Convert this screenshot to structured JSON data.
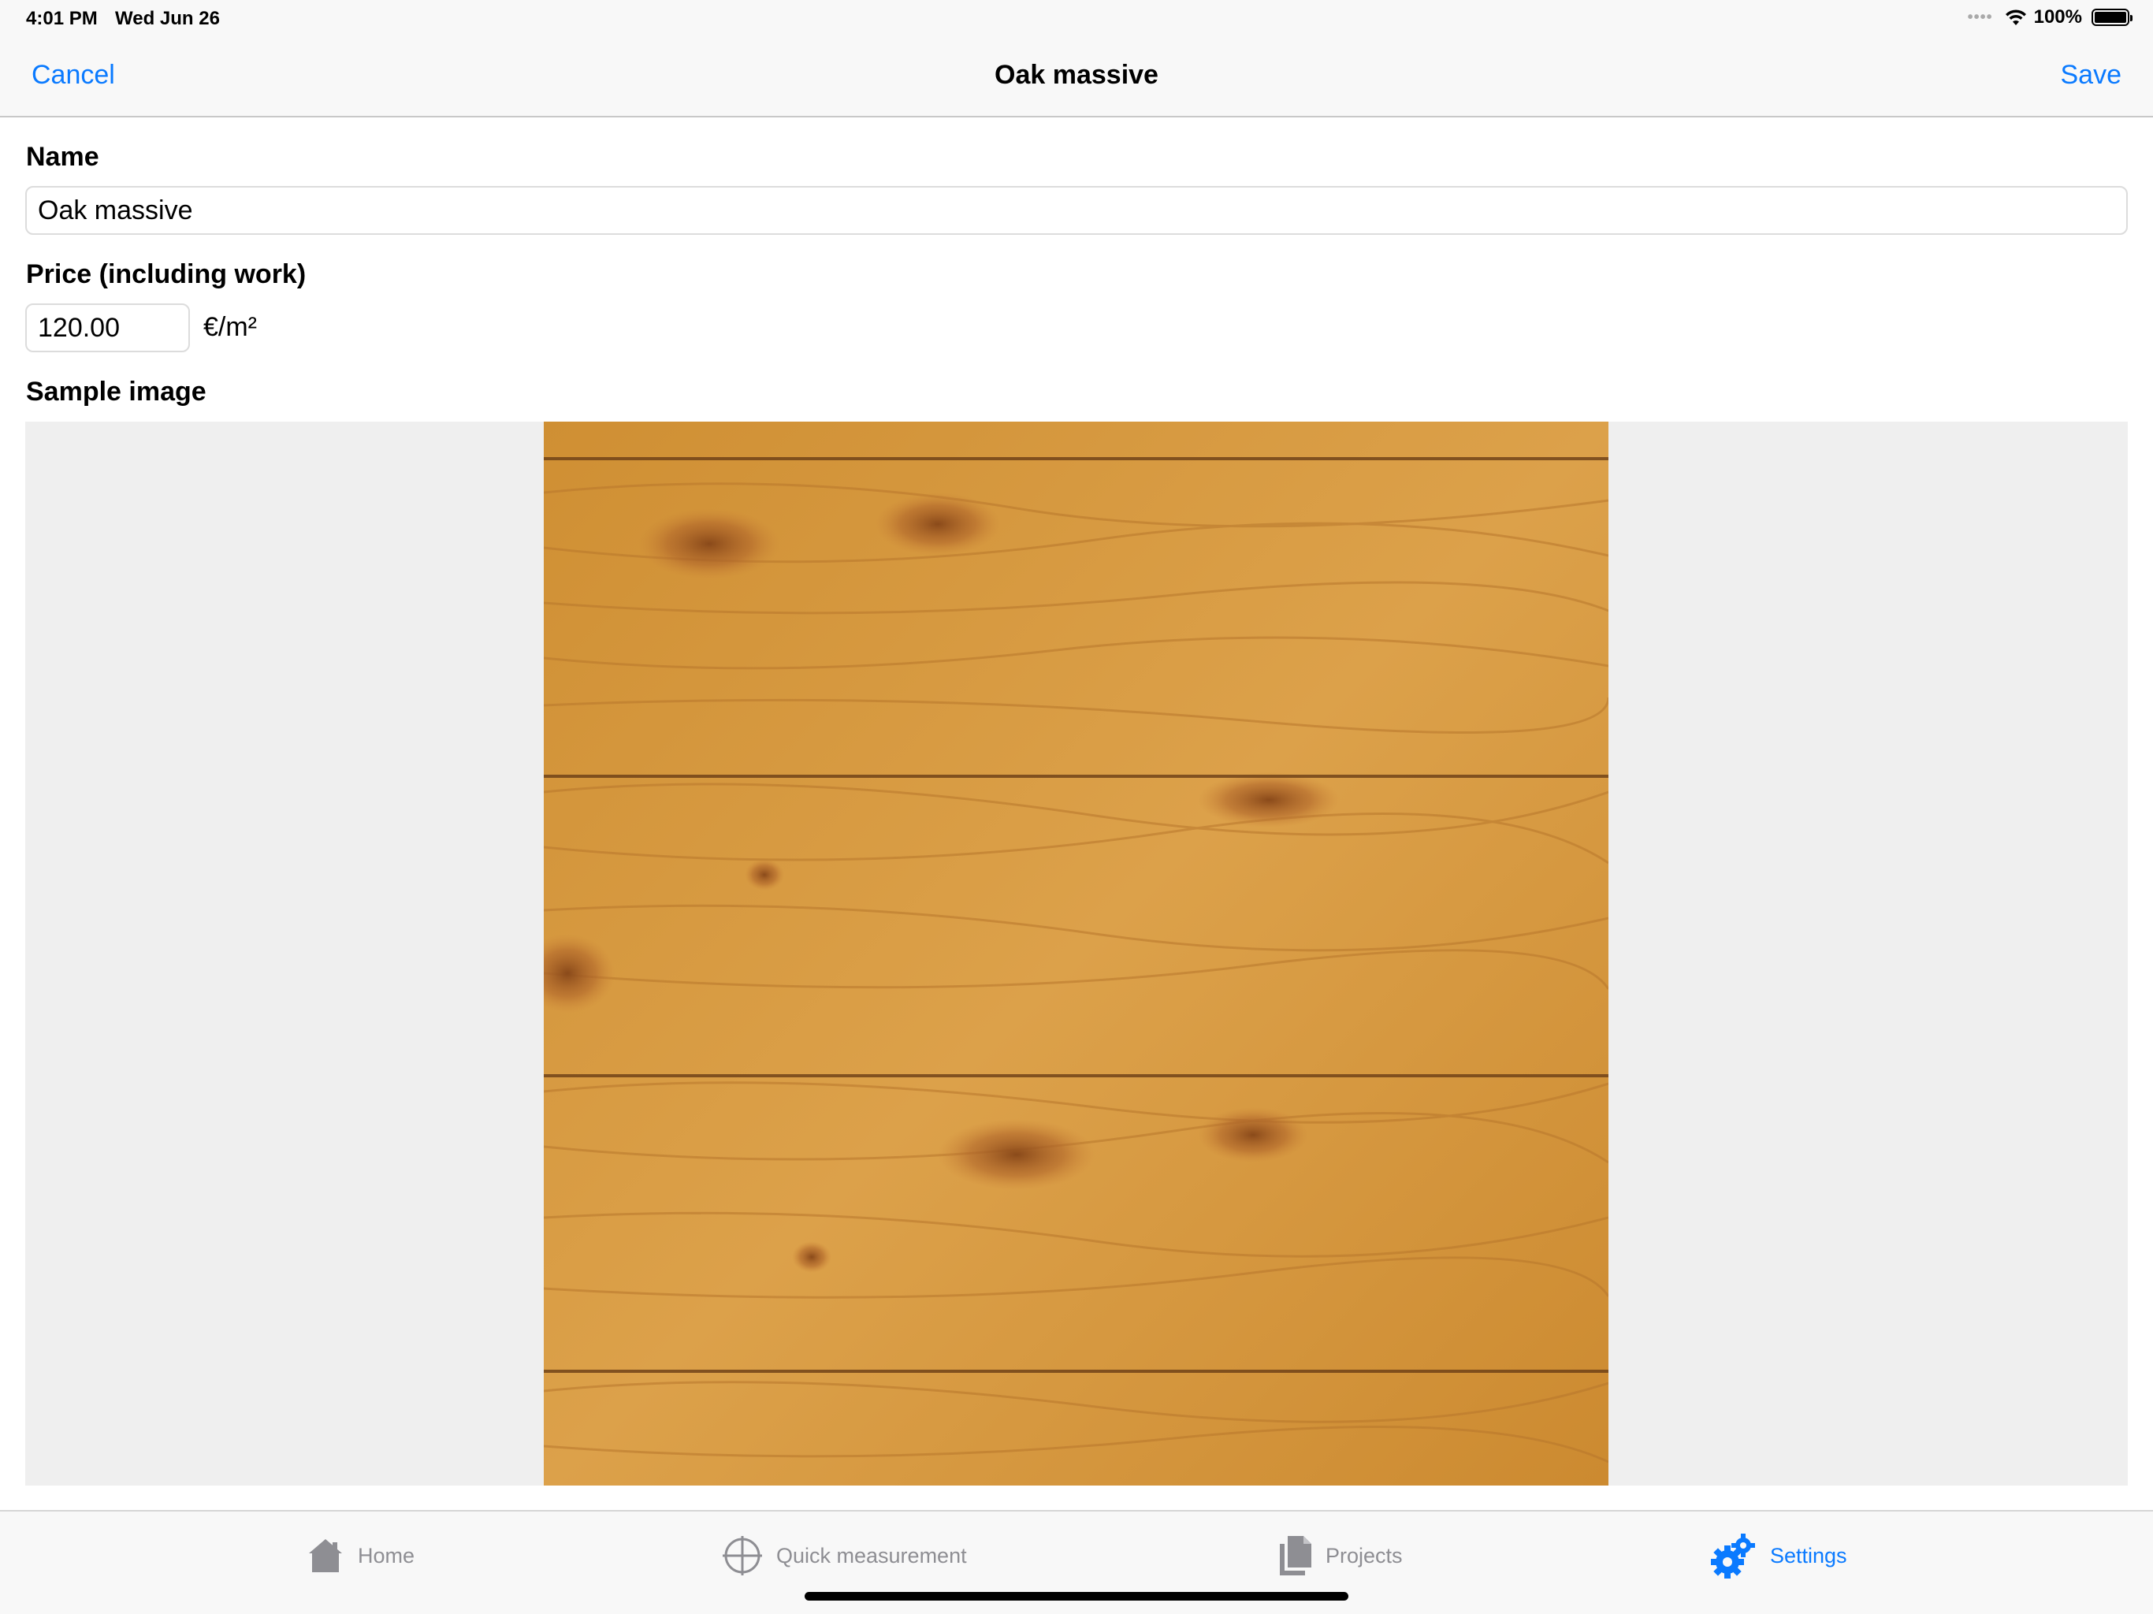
{
  "status_bar": {
    "time": "4:01 PM",
    "date": "Wed Jun 26",
    "battery": "100%"
  },
  "nav": {
    "cancel_label": "Cancel",
    "title": "Oak massive",
    "save_label": "Save"
  },
  "form": {
    "name_label": "Name",
    "name_value": "Oak massive",
    "price_label": "Price (including work)",
    "price_value": "120.00",
    "price_unit": "€/m²",
    "sample_label": "Sample image"
  },
  "tabs": [
    {
      "label": "Home",
      "icon": "house-icon",
      "active": false
    },
    {
      "label": "Quick measurement",
      "icon": "crosshair-icon",
      "active": false
    },
    {
      "label": "Projects",
      "icon": "documents-icon",
      "active": false
    },
    {
      "label": "Settings",
      "icon": "gears-icon",
      "active": true
    }
  ],
  "colors": {
    "accent": "#0a7aff",
    "inactive_tab": "#8e8e93",
    "wood": "#d69a3c"
  }
}
